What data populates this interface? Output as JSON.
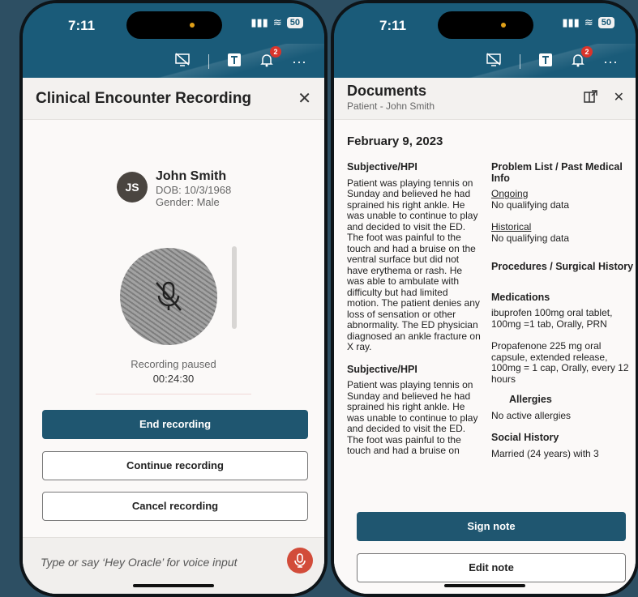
{
  "status_bar": {
    "time": "7:11",
    "battery": "50"
  },
  "toolbar": {
    "notification_count": "2",
    "more": "···"
  },
  "recording": {
    "title": "Clinical Encounter Recording",
    "patient": {
      "initials": "JS",
      "name": "John Smith",
      "dob": "DOB: 10/3/1968",
      "gender": "Gender: Male"
    },
    "status": "Recording paused",
    "elapsed": "00:24:30",
    "end_label": "End recording",
    "continue_label": "Continue recording",
    "cancel_label": "Cancel recording",
    "voice_placeholder": "Type or say ‘Hey Oracle’ for voice input"
  },
  "documents": {
    "title": "Documents",
    "subtitle": "Patient - John Smith",
    "date": "February 9, 2023",
    "left_sections": [
      {
        "heading": "Subjective/HPI",
        "body": "Patient was playing tennis on Sunday and believed he had sprained his right ankle.  He was unable to continue to play and decided to visit the ED.  The foot was painful to the touch and had a bruise on the ventral surface but did not have erythema or rash.  He was able to ambulate with difficulty but had limited motion. The patient denies any loss of sensation or other abnormality.  The ED physician diagnosed an ankle fracture on X ray."
      },
      {
        "heading": "Subjective/HPI",
        "body": "Patient was playing tennis on Sunday and believed he had sprained his right ankle.  He was unable to continue to play and decided to visit the ED.  The foot was painful to the touch and had a bruise on"
      }
    ],
    "problem_list": {
      "heading": "Problem List / Past Medical Info",
      "ongoing_label": "Ongoing",
      "ongoing_value": "No qualifying data",
      "historical_label": "Historical",
      "historical_value": "No qualifying data"
    },
    "procedures_heading": "Procedures / Surgical History",
    "medications": {
      "heading": "Medications",
      "items": [
        "ibuprofen 100mg oral tablet, 100mg =1 tab, Orally, PRN",
        "Propafenone 225 mg oral capsule, extended release, 100mg = 1 cap, Orally, every 12 hours"
      ]
    },
    "allergies": {
      "heading": "Allergies",
      "value": "No active allergies"
    },
    "social_history": {
      "heading": "Social History",
      "value": "Married (24 years) with 3"
    },
    "sign_label": "Sign note",
    "edit_label": "Edit note"
  },
  "colors": {
    "brand": "#1a5b79",
    "primary_button": "#1f5670",
    "mic_button": "#d24c3a",
    "badge": "#d9342b"
  }
}
